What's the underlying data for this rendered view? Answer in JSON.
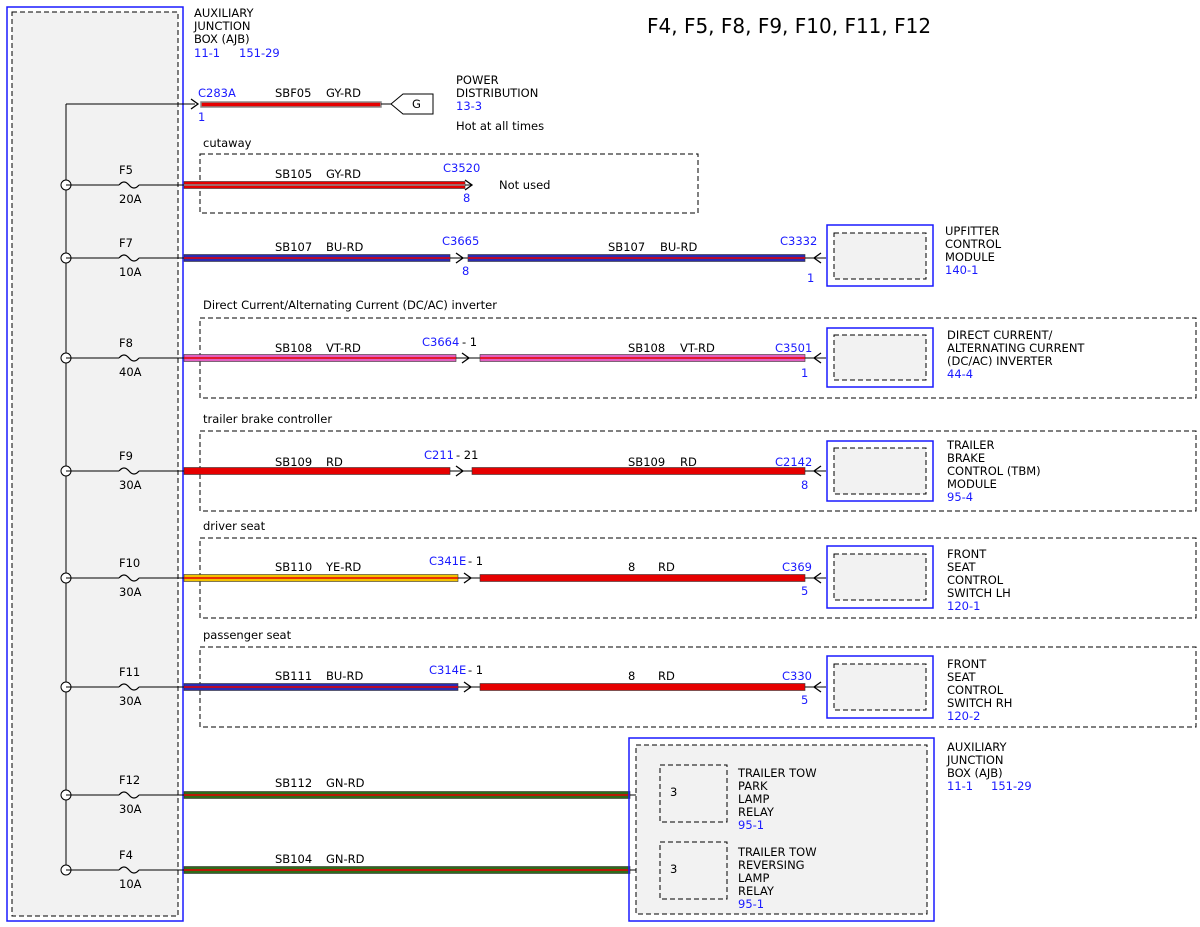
{
  "title": "F4, F5, F8, F9, F10, F11, F12",
  "ajb": {
    "line1": "AUXILIARY",
    "line2": "JUNCTION",
    "line3": "BOX (AJB)",
    "ref1": "11-1",
    "ref2": "151-29"
  },
  "power": {
    "connector": "C283A",
    "pin": "1",
    "circuit": "SBF05",
    "color": "GY-RD",
    "symbol": "G",
    "line1": "POWER",
    "line2": "DISTRIBUTION",
    "ref": "13-3",
    "note": "Hot at all times"
  },
  "rows": [
    {
      "fuse": "F5",
      "amps": "20A",
      "option": "cutaway",
      "circuit": "SB105",
      "color": "GY-RD",
      "connector": "C3520",
      "pin": "8",
      "note": "Not used"
    },
    {
      "fuse": "F7",
      "amps": "10A",
      "circuit": "SB107",
      "color": "BU-RD",
      "connector": "C3665",
      "pin": "8",
      "circuit2": "SB107",
      "color2": "BU-RD",
      "end_connector": "C3332",
      "end_pin": "1",
      "component": [
        "UPFITTER",
        "CONTROL",
        "MODULE"
      ],
      "component_ref": "140-1"
    },
    {
      "fuse": "F8",
      "amps": "40A",
      "option": "Direct Current/Alternating Current (DC/AC) inverter",
      "circuit": "SB108",
      "color": "VT-RD",
      "connector": "C3664",
      "pin": "- 1",
      "circuit2": "SB108",
      "color2": "VT-RD",
      "end_connector": "C3501",
      "end_pin": "1",
      "component": [
        "DIRECT CURRENT/",
        "ALTERNATING CURRENT",
        "(DC/AC) INVERTER"
      ],
      "component_ref": "44-4"
    },
    {
      "fuse": "F9",
      "amps": "30A",
      "option": "trailer brake controller",
      "circuit": "SB109",
      "color": "RD",
      "connector": "C211",
      "pin": "- 21",
      "circuit2": "SB109",
      "color2": "RD",
      "end_connector": "C2142",
      "end_pin": "8",
      "component": [
        "TRAILER",
        "BRAKE",
        "CONTROL (TBM)",
        "MODULE"
      ],
      "component_ref": "95-4"
    },
    {
      "fuse": "F10",
      "amps": "30A",
      "option": "driver seat",
      "circuit": "SB110",
      "color": "YE-RD",
      "connector": "C341E",
      "pin": "- 1",
      "circuit2": "8",
      "color2": "RD",
      "end_connector": "C369",
      "end_pin": "5",
      "component": [
        "FRONT",
        "SEAT",
        "CONTROL",
        "SWITCH LH"
      ],
      "component_ref": "120-1"
    },
    {
      "fuse": "F11",
      "amps": "30A",
      "option": "passenger seat",
      "circuit": "SB111",
      "color": "BU-RD",
      "connector": "C314E",
      "pin": "- 1",
      "circuit2": "8",
      "color2": "RD",
      "end_connector": "C330",
      "end_pin": "5",
      "component": [
        "FRONT",
        "SEAT",
        "CONTROL",
        "SWITCH RH"
      ],
      "component_ref": "120-2"
    },
    {
      "fuse": "F12",
      "amps": "30A",
      "circuit": "SB112",
      "color": "GN-RD",
      "relay_pin": "3",
      "relay": [
        "TRAILER TOW",
        "PARK",
        "LAMP",
        "RELAY"
      ],
      "relay_ref": "95-1"
    },
    {
      "fuse": "F4",
      "amps": "10A",
      "circuit": "SB104",
      "color": "GN-RD",
      "relay_pin": "3",
      "relay": [
        "TRAILER TOW",
        "REVERSING",
        "LAMP",
        "RELAY"
      ],
      "relay_ref": "95-1"
    }
  ],
  "ajb2": {
    "line1": "AUXILIARY",
    "line2": "JUNCTION",
    "line3": "BOX (AJB)",
    "ref1": "11-1",
    "ref2": "151-29"
  },
  "colors": {
    "gray": "#8a8a8a",
    "red": "#e60000",
    "blue": "#2b2bb0",
    "violet": "#e060c0",
    "yellow": "#f2c200",
    "green": "#2f6b1a",
    "ink_blue": "#1a1aff",
    "box_fill": "#f2f2f2"
  }
}
